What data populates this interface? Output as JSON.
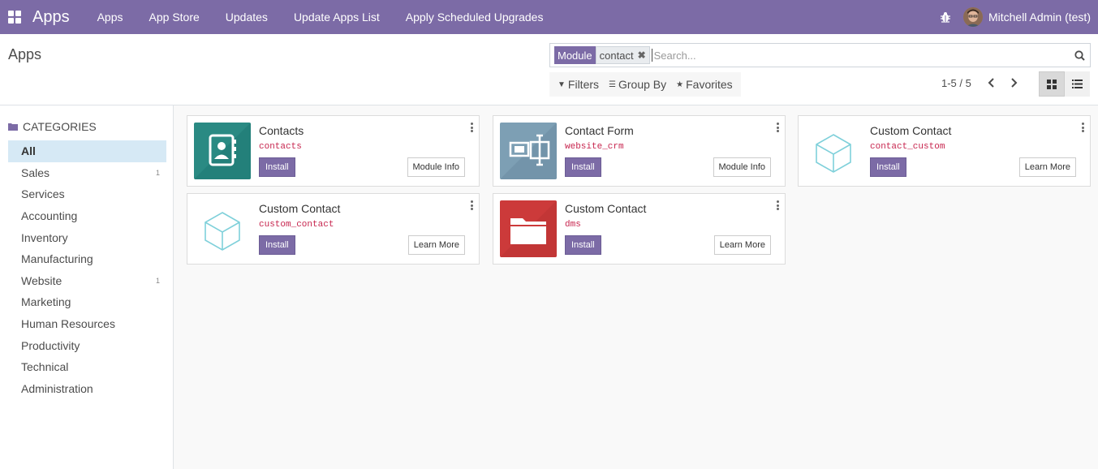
{
  "navbar": {
    "brand": "Apps",
    "menu": [
      "Apps",
      "App Store",
      "Updates",
      "Update Apps List",
      "Apply Scheduled Upgrades"
    ],
    "user": "Mitchell Admin (test)",
    "color": "#7c6ba6"
  },
  "control_panel": {
    "title": "Apps",
    "search": {
      "facet_label": "Module",
      "facet_value": "contact",
      "placeholder": "Search..."
    },
    "filters_label": "Filters",
    "groupby_label": "Group By",
    "favorites_label": "Favorites",
    "pager": "1-5 / 5"
  },
  "sidebar": {
    "header": "CATEGORIES",
    "items": [
      {
        "label": "All",
        "count": "",
        "active": true
      },
      {
        "label": "Sales",
        "count": "1"
      },
      {
        "label": "Services",
        "count": ""
      },
      {
        "label": "Accounting",
        "count": ""
      },
      {
        "label": "Inventory",
        "count": ""
      },
      {
        "label": "Manufacturing",
        "count": ""
      },
      {
        "label": "Website",
        "count": "1"
      },
      {
        "label": "Marketing",
        "count": ""
      },
      {
        "label": "Human Resources",
        "count": ""
      },
      {
        "label": "Productivity",
        "count": ""
      },
      {
        "label": "Technical",
        "count": ""
      },
      {
        "label": "Administration",
        "count": ""
      }
    ]
  },
  "modules": [
    {
      "title": "Contacts",
      "tech": "contacts",
      "install": "Install",
      "info": "Module Info",
      "icon": "contacts-book-icon"
    },
    {
      "title": "Contact Form",
      "tech": "website_crm",
      "install": "Install",
      "info": "Module Info",
      "icon": "contact-form-icon"
    },
    {
      "title": "Custom Contact",
      "tech": "contact_custom",
      "install": "Install",
      "info": "Learn More",
      "icon": "cube-icon"
    },
    {
      "title": "Custom Contact",
      "tech": "custom_contact",
      "install": "Install",
      "info": "Learn More",
      "icon": "cube-icon"
    },
    {
      "title": "Custom Contact",
      "tech": "dms",
      "install": "Install",
      "info": "Learn More",
      "icon": "folder-icon"
    }
  ]
}
